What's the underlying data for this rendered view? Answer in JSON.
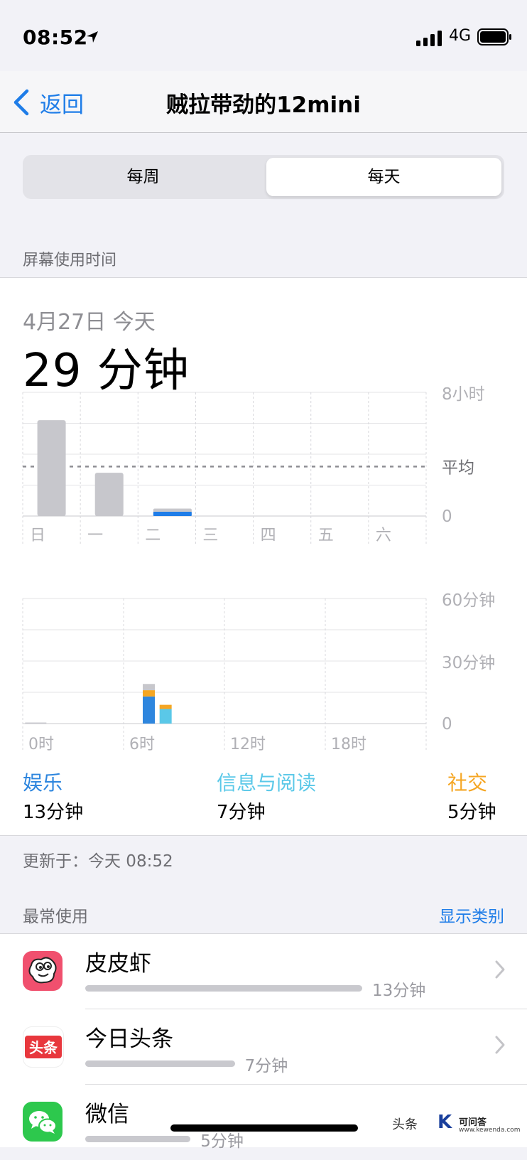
{
  "status_bar": {
    "time": "08:52",
    "network": "4G",
    "icons": [
      "location-arrow-icon",
      "signal-icon",
      "battery-icon"
    ]
  },
  "nav": {
    "back_label": "返回",
    "title": "贼拉带劲的12mini"
  },
  "segment": {
    "weekly": "每周",
    "daily": "每天",
    "selected": "daily"
  },
  "section_header": "屏幕使用时间",
  "summary": {
    "date": "4月27日 今天",
    "total": "29 分钟"
  },
  "chart_data": [
    {
      "type": "bar",
      "categories": [
        "日",
        "一",
        "二",
        "三",
        "四",
        "五",
        "六"
      ],
      "y_ticks": [
        "8小时",
        "平均",
        "0"
      ],
      "ylim_hours": [
        0,
        8
      ],
      "average_hours": 3.2,
      "series": [
        {
          "values_hours": [
            6.2,
            2.8,
            0.48,
            0,
            0,
            0,
            0
          ]
        }
      ],
      "highlight_category": "二",
      "grid": true
    },
    {
      "type": "bar",
      "x_ticks": [
        "0时",
        "6时",
        "12时",
        "18时"
      ],
      "y_ticks": [
        "60分钟",
        "30分钟",
        "0"
      ],
      "ylim_minutes": [
        0,
        60
      ],
      "stacked": true,
      "bars": [
        {
          "hour": 0,
          "segments": [
            {
              "category": "other",
              "minutes": 0.5
            }
          ]
        },
        {
          "hour": 7,
          "segments": [
            {
              "category": "entertainment",
              "minutes": 13
            },
            {
              "category": "social",
              "minutes": 3
            },
            {
              "category": "other",
              "minutes": 3
            }
          ]
        },
        {
          "hour": 8,
          "segments": [
            {
              "category": "info_reading",
              "minutes": 7
            },
            {
              "category": "social",
              "minutes": 2
            }
          ]
        }
      ],
      "grid": true
    }
  ],
  "categories": [
    {
      "name": "娱乐",
      "time": "13分钟",
      "color": "#2e86de"
    },
    {
      "name": "信息与阅读",
      "time": "7分钟",
      "color": "#5ac8e8"
    },
    {
      "name": "社交",
      "time": "5分钟",
      "color": "#f5a623"
    }
  ],
  "colors": {
    "other": "#c7c7cc",
    "accent": "#1f7de8"
  },
  "updated": "更新于：今天 08:52",
  "most_used": {
    "title": "最常使用",
    "show_categories": "显示类别"
  },
  "apps": [
    {
      "name": "皮皮虾",
      "time": "13分钟",
      "fraction": 1.0
    },
    {
      "name": "今日头条",
      "time": "7分钟",
      "fraction": 0.54
    },
    {
      "name": "微信",
      "time": "5分钟",
      "fraction": 0.38
    }
  ],
  "watermark": {
    "text": "头条",
    "brand": "可问答",
    "url": "www.kewenda.com",
    "logo": "K"
  }
}
